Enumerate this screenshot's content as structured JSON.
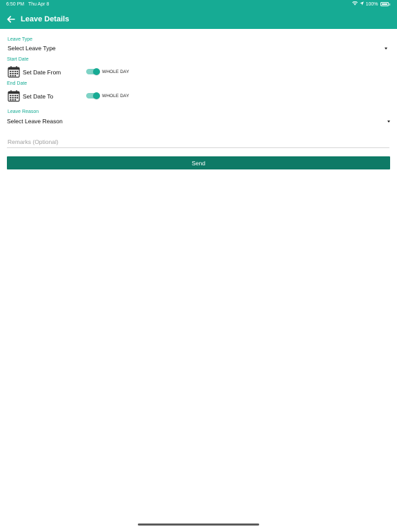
{
  "status_bar": {
    "time": "6:50 PM",
    "date": "Thu Apr 8",
    "battery": "100%"
  },
  "header": {
    "title": "Leave Details",
    "back_icon": "arrow-left-icon",
    "background_color": "#16ab94"
  },
  "form": {
    "leave_type": {
      "label": "Leave Type",
      "value": "Select Leave Type"
    },
    "start_date": {
      "label": "Start Date",
      "value": "Set Date From",
      "toggle_label": "WHOLE DAY",
      "toggle_on": true
    },
    "end_date": {
      "label": "End Date",
      "value": "Set Date To",
      "toggle_label": "WHOLE DAY",
      "toggle_on": true
    },
    "leave_reason": {
      "label": "Leave Reason",
      "value": "Select Leave Reason"
    },
    "remarks": {
      "placeholder": "Remarks (Optional)",
      "value": ""
    },
    "send_label": "Send"
  },
  "colors": {
    "accent": "#16ab94",
    "button": "#0e7a66"
  }
}
